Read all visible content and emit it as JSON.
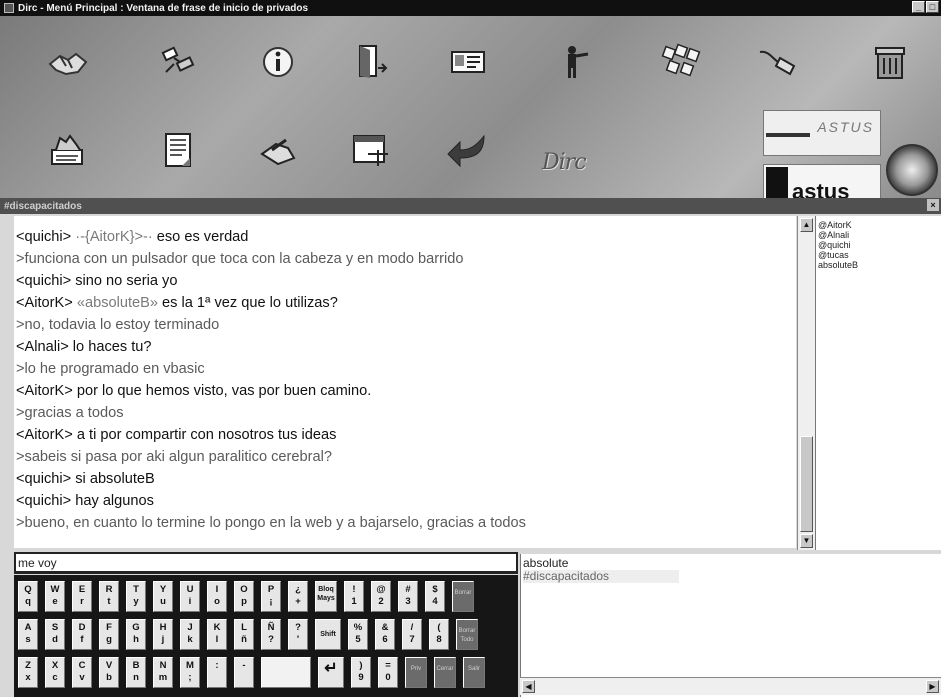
{
  "window": {
    "title": "Dirc - Menú Principal : Ventana de frase de inicio de privados",
    "buttons": [
      "_",
      "□",
      "×"
    ]
  },
  "toolbar": {
    "icons": [
      "handshake-icon",
      "satellite-icon",
      "info-icon",
      "exit-door-icon",
      "id-card-icon",
      "person-at-desk-icon",
      "keyboard-keys-icon",
      "cable-plug-icon",
      "trash-can-icon",
      "hand-tools-icon",
      "document-icon",
      "hand-writing-icon",
      "window-list-icon",
      "back-arrow-icon"
    ],
    "brand": "D",
    "brand_tail": "irc",
    "sponsor_name": "ASTUS",
    "astus_label": "astus"
  },
  "channel": {
    "title": "#discapacitados",
    "close_label": "×"
  },
  "messages": [
    {
      "type": "speaker",
      "text": "<quichi> ",
      "ref": "·-{AitorK}>-·",
      "tail": " eso es verdad"
    },
    {
      "type": "echo",
      "text": ">funciona con un pulsador que toca con la cabeza y en modo barrido"
    },
    {
      "type": "speaker",
      "text": "<quichi> sino no seria yo"
    },
    {
      "type": "speaker",
      "text": "<AitorK> ",
      "ref": "«absoluteB»",
      "tail": " es la 1ª vez que lo utilizas?"
    },
    {
      "type": "echo",
      "text": ">no, todavia lo estoy terminado"
    },
    {
      "type": "speaker",
      "text": "<Alnali> lo haces tu?"
    },
    {
      "type": "echo",
      "text": ">lo he programado en vbasic"
    },
    {
      "type": "speaker",
      "text": "<AitorK> por lo que hemos visto, vas por buen camino."
    },
    {
      "type": "echo",
      "text": ">gracias a todos"
    },
    {
      "type": "speaker",
      "text": "<AitorK> a ti por compartir con nosotros tus ideas"
    },
    {
      "type": "echo",
      "text": ">sabeis si pasa por aki algun paralitico cerebral?"
    },
    {
      "type": "speaker",
      "text": "<quichi> si absoluteB"
    },
    {
      "type": "speaker",
      "text": "<quichi> hay algunos"
    },
    {
      "type": "echo",
      "text": ">bueno, en cuanto lo termine lo pongo en la web y a bajarselo, gracias a todos"
    }
  ],
  "nicklist": [
    "@AitorK",
    "@Alnali",
    "@quichi",
    "@tucas",
    "absoluteB"
  ],
  "input": {
    "value": "me voy"
  },
  "keyboard": {
    "row1": [
      [
        "Q",
        "q"
      ],
      [
        "W",
        "e"
      ],
      [
        "E",
        "r"
      ],
      [
        "R",
        "t"
      ],
      [
        "T",
        "y"
      ],
      [
        "Y",
        "u"
      ],
      [
        "U",
        "i"
      ],
      [
        "I",
        "o"
      ],
      [
        "O",
        "p"
      ],
      [
        "P",
        "¡"
      ],
      [
        "¿",
        "+"
      ],
      [
        "Bloq",
        "Mays"
      ],
      [
        "!",
        "1"
      ],
      [
        "@",
        "2"
      ],
      [
        "#",
        "3"
      ],
      [
        "$",
        "4"
      ],
      [
        "Borrar",
        ""
      ]
    ],
    "row2": [
      [
        "A",
        "s"
      ],
      [
        "S",
        "d"
      ],
      [
        "D",
        "f"
      ],
      [
        "F",
        "g"
      ],
      [
        "G",
        "h"
      ],
      [
        "H",
        "j"
      ],
      [
        "J",
        "k"
      ],
      [
        "K",
        "l"
      ],
      [
        "L",
        "ñ"
      ],
      [
        "Ñ",
        "?"
      ],
      [
        "?",
        "'"
      ],
      [
        "Shift",
        ""
      ],
      [
        "%",
        "5"
      ],
      [
        "&",
        "6"
      ],
      [
        "/",
        "7"
      ],
      [
        "(",
        "8"
      ],
      [
        "Borrar",
        "Todo"
      ]
    ],
    "row3": [
      [
        "Z",
        "x"
      ],
      [
        "X",
        "c"
      ],
      [
        "C",
        "v"
      ],
      [
        "V",
        "b"
      ],
      [
        "B",
        "n"
      ],
      [
        "N",
        "m"
      ],
      [
        "M",
        ";"
      ],
      [
        ":",
        ""
      ],
      [
        "-",
        ""
      ],
      [
        "space",
        ""
      ],
      [
        "enter",
        "↵"
      ],
      [
        ")",
        "9"
      ],
      [
        "=",
        "0"
      ],
      [
        "Priv",
        ""
      ],
      [
        "Cerrar",
        ""
      ],
      [
        "Salir",
        ""
      ]
    ]
  },
  "channels": [
    "absolute",
    "#discapacitados"
  ]
}
